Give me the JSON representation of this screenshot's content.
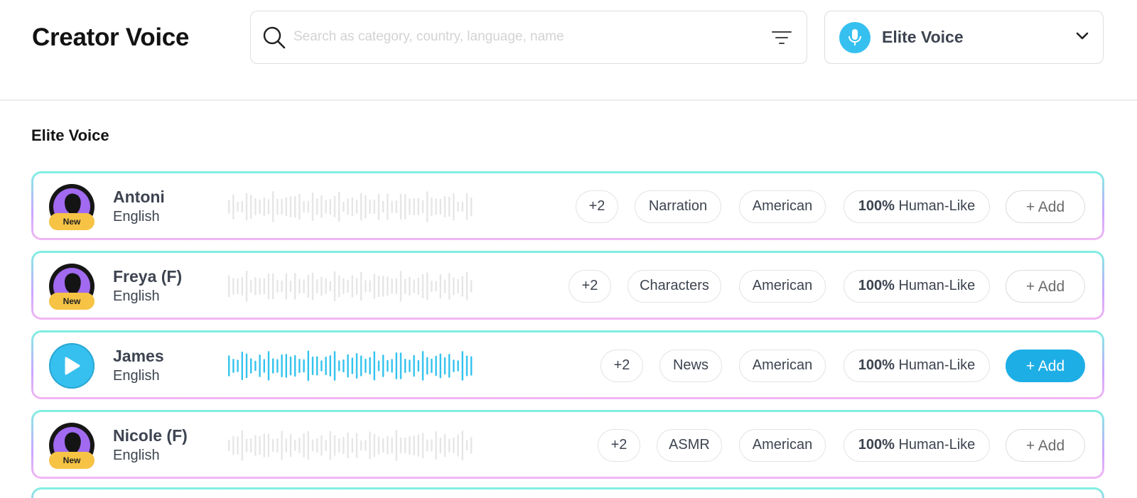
{
  "header": {
    "app_title": "Creator Voice",
    "search": {
      "value": "",
      "placeholder": "Search as category, country, language, name"
    },
    "voice_select": {
      "selected": "Elite Voice"
    }
  },
  "section": {
    "title": "Elite Voice"
  },
  "voices": [
    {
      "name": "Antoni",
      "language": "English",
      "badge": "New",
      "extra_tags": "+2",
      "category": "Narration",
      "accent": "American",
      "humanlike_percent": "100%",
      "humanlike_label": "Human-Like",
      "add_label": "+ Add",
      "state": "idle"
    },
    {
      "name": "Freya (F)",
      "language": "English",
      "badge": "New",
      "extra_tags": "+2",
      "category": "Characters",
      "accent": "American",
      "humanlike_percent": "100%",
      "humanlike_label": "Human-Like",
      "add_label": "+ Add",
      "state": "idle"
    },
    {
      "name": "James",
      "language": "English",
      "badge": "",
      "extra_tags": "+2",
      "category": "News",
      "accent": "American",
      "humanlike_percent": "100%",
      "humanlike_label": "Human-Like",
      "add_label": "+ Add",
      "state": "active"
    },
    {
      "name": "Nicole (F)",
      "language": "English",
      "badge": "New",
      "extra_tags": "+2",
      "category": "ASMR",
      "accent": "American",
      "humanlike_percent": "100%",
      "humanlike_label": "Human-Like",
      "add_label": "+ Add",
      "state": "idle"
    }
  ],
  "colors": {
    "accent": "#36c0f0",
    "add_active": "#1eaee6",
    "avatar_purple": "#a16af0",
    "badge_yellow": "#f6c344",
    "waveform_idle": "#e6e6e6",
    "waveform_active": "#33c3ee"
  },
  "icons": [
    "search-icon",
    "filter-icon",
    "microphone-icon",
    "chevron-down-icon",
    "avatar-silhouette-icon",
    "play-icon",
    "waveform"
  ]
}
